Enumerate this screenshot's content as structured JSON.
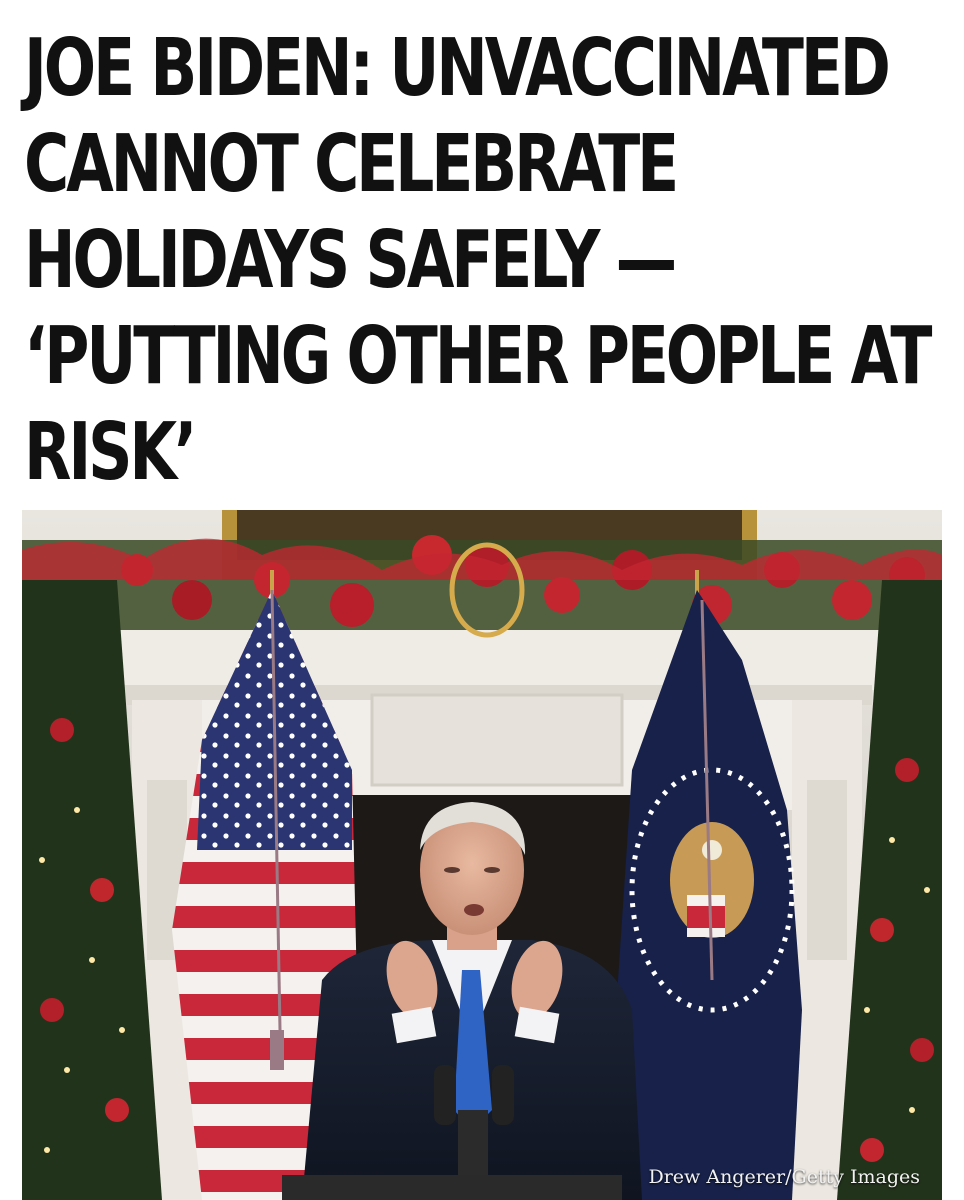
{
  "article": {
    "headline_lines": [
      "JOE BIDEN: UNVACCINATED",
      "CANNOT CELEBRATE",
      "HOLIDAYS SAFELY —",
      "‘PUTTING OTHER PEOPLE AT",
      "RISK’"
    ],
    "photo_credit": "Drew Angerer/Getty Images"
  }
}
